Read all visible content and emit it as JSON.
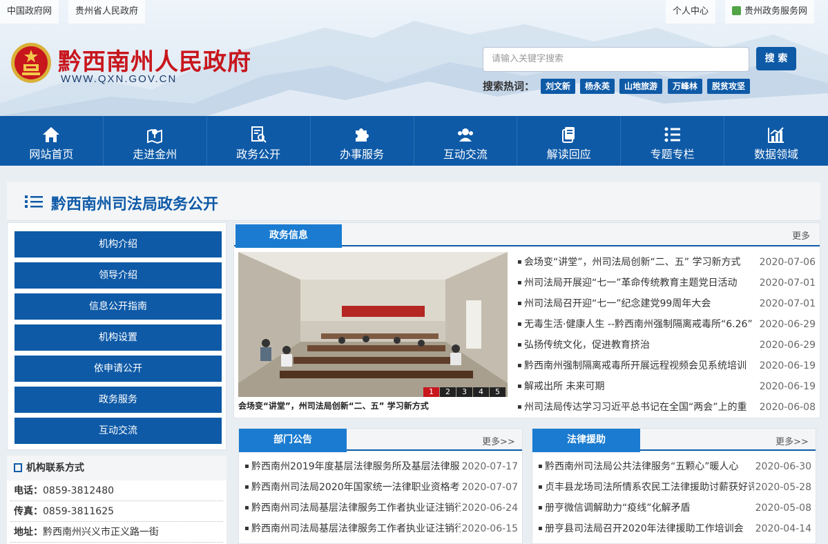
{
  "topbar": {
    "links_left": [
      "中国政府网",
      "贵州省人民政府"
    ],
    "links_right": [
      "个人中心",
      "贵州政务服务网"
    ]
  },
  "header": {
    "title": "黔西南州人民政府",
    "url": "WWW.QXN.GOV.CN",
    "search": {
      "placeholder": "请输入关键字搜索",
      "button": "搜 索"
    },
    "hot_label": "搜索热词：",
    "hot_tags": [
      "刘文新",
      "杨永英",
      "山地旅游",
      "万峰林",
      "脱贫攻坚"
    ]
  },
  "nav": [
    {
      "label": "网站首页",
      "icon": "home-icon"
    },
    {
      "label": "走进金州",
      "icon": "map-location-icon"
    },
    {
      "label": "政务公开",
      "icon": "document-search-icon"
    },
    {
      "label": "办事服务",
      "icon": "puzzle-icon"
    },
    {
      "label": "互动交流",
      "icon": "users-icon"
    },
    {
      "label": "解读回应",
      "icon": "files-icon"
    },
    {
      "label": "专题专栏",
      "icon": "list-icon"
    },
    {
      "label": "数据领域",
      "icon": "chart-icon"
    }
  ],
  "page": {
    "title": "黔西南州司法局政务公开"
  },
  "side_menu": [
    "机构介绍",
    "领导介绍",
    "信息公开指南",
    "机构设置",
    "依申请公开",
    "政务服务",
    "互动交流"
  ],
  "contact": {
    "title": "机构联系方式",
    "rows": [
      {
        "label": "电话：",
        "value": "0859-3812480"
      },
      {
        "label": "传真：",
        "value": "0859-3811625"
      },
      {
        "label": "地址：",
        "value": "黔西南州兴义市正义路一街"
      }
    ]
  },
  "main_news": {
    "tab": "政务信息",
    "more": "更多",
    "photo_caption": "会场变“讲堂”，州司法局创新“二、五” 学习新方式",
    "pager": [
      "1",
      "2",
      "3",
      "4",
      "5"
    ],
    "items": [
      {
        "title": "会场变“讲堂”，州司法局创新“二、五” 学习新方式",
        "date": "2020-07-06"
      },
      {
        "title": "州司法局开展迎“七一”革命传统教育主题党日活动",
        "date": "2020-07-01"
      },
      {
        "title": "州司法局召开迎“七一”纪念建党99周年大会",
        "date": "2020-07-01"
      },
      {
        "title": "无毒生活·健康人生 --黔西南州强制隔离戒毒所“6.26”",
        "date": "2020-06-29"
      },
      {
        "title": "弘扬传统文化，促进教育挤治",
        "date": "2020-06-29"
      },
      {
        "title": "黔西南州强制隔离戒毒所开展远程视频会见系统培训",
        "date": "2020-06-19"
      },
      {
        "title": "解戒出所 未来可期",
        "date": "2020-06-19"
      },
      {
        "title": "州司法局传达学习习近平总书记在全国“两会”上的重",
        "date": "2020-06-08"
      }
    ]
  },
  "dept_notice": {
    "tab": "部门公告",
    "more": "更多>>",
    "items": [
      {
        "title": "黔西南州2019年度基层法律服务所及基层法律服",
        "date": "2020-07-17"
      },
      {
        "title": "黔西南州司法局2020年国家统一法律职业资格考",
        "date": "2020-07-07"
      },
      {
        "title": "黔西南州司法局基层法律服务工作者执业证注销行",
        "date": "2020-06-24"
      },
      {
        "title": "黔西南州司法局基层法律服务工作者执业证注销行",
        "date": "2020-06-15"
      }
    ]
  },
  "legal_aid": {
    "tab": "法律援助",
    "more": "更多>>",
    "items": [
      {
        "title": "黔西南州司法局公共法律服务“五颗心”暖人心",
        "date": "2020-06-30"
      },
      {
        "title": "贞丰县龙场司法所情系农民工法律援助讨薪获好评",
        "date": "2020-05-28"
      },
      {
        "title": "册亨微信调解助力“疫线”化解矛盾",
        "date": "2020-05-08"
      },
      {
        "title": "册亨县司法局召开2020年法律援助工作培训会",
        "date": "2020-04-14"
      }
    ]
  }
}
